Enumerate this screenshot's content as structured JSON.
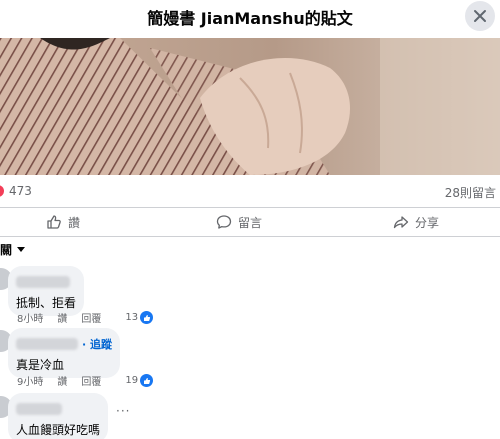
{
  "header": {
    "title": "簡嫚書 JianManshu的貼文"
  },
  "post": {
    "reaction_count": "473",
    "comments_count": "28則留言"
  },
  "actions": {
    "like": "讚",
    "comment": "留言",
    "share": "分享"
  },
  "sort": {
    "label": "關"
  },
  "comments": [
    {
      "text": "抵制、拒看",
      "time": "8小時",
      "like": "讚",
      "reply": "回覆",
      "likes": "13"
    },
    {
      "follow": "· 追蹤",
      "text": "真是冷血",
      "time": "9小時",
      "like": "讚",
      "reply": "回覆",
      "likes": "19"
    },
    {
      "text": "人血饅頭好吃嗎",
      "more": "···"
    }
  ],
  "colors": {
    "accent": "#1877f2",
    "love": "#f33e58",
    "bubble": "#f0f2f5"
  }
}
